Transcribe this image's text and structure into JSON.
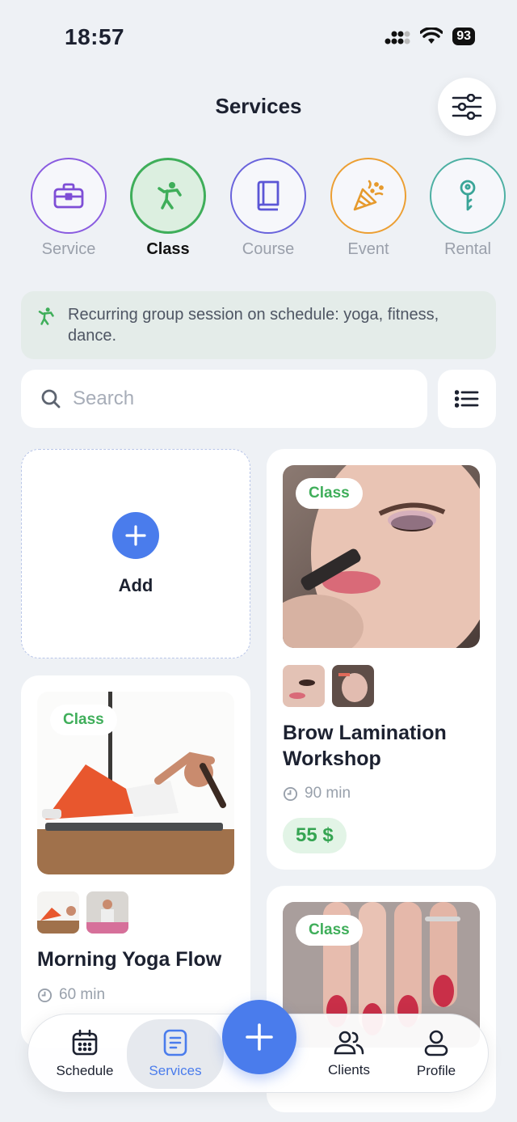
{
  "status_bar": {
    "time": "18:57",
    "battery": "93"
  },
  "header": {
    "title": "Services"
  },
  "categories": [
    {
      "label": "Service",
      "color": "#7e4ed6",
      "icon": "briefcase-icon"
    },
    {
      "label": "Class",
      "color": "#3fae5a",
      "icon": "martial-arts-icon"
    },
    {
      "label": "Course",
      "color": "#5b56d6",
      "icon": "book-icon"
    },
    {
      "label": "Event",
      "color": "#e69a2d",
      "icon": "party-popper-icon"
    },
    {
      "label": "Rental",
      "color": "#3aa598",
      "icon": "key-icon"
    }
  ],
  "banner": {
    "text": "Recurring group session on schedule: yoga, fitness, dance."
  },
  "search": {
    "placeholder": "Search"
  },
  "add_card": {
    "label": "Add"
  },
  "cards": [
    {
      "badge": "Class",
      "title": "Brow Lamination Workshop",
      "duration": "90 min",
      "price": "55 $"
    },
    {
      "badge": "Class",
      "title": "Morning Yoga Flow",
      "duration": "60 min"
    },
    {
      "badge": "Class"
    }
  ],
  "nav": {
    "items": [
      {
        "label": "Schedule",
        "icon": "calendar-icon"
      },
      {
        "label": "Services",
        "icon": "document-icon"
      },
      {
        "label": "Clients",
        "icon": "users-icon"
      },
      {
        "label": "Profile",
        "icon": "person-icon"
      }
    ]
  },
  "colors": {
    "accent": "#4a7cec",
    "green": "#3fae5a"
  }
}
